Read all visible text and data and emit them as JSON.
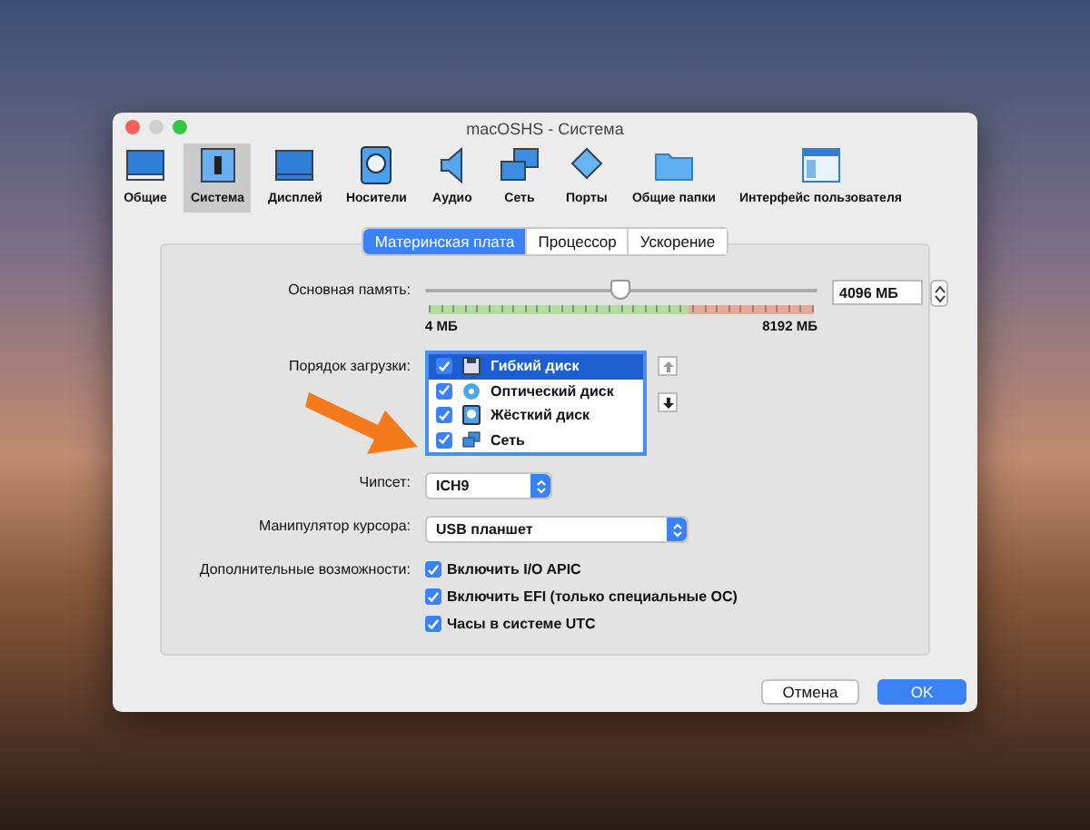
{
  "window": {
    "title": "macOSHS - Система"
  },
  "toolbar": [
    {
      "label": "Общие",
      "kind": "general",
      "selected": false
    },
    {
      "label": "Система",
      "kind": "system",
      "selected": true
    },
    {
      "label": "Дисплей",
      "kind": "display",
      "selected": false
    },
    {
      "label": "Носители",
      "kind": "storage",
      "selected": false
    },
    {
      "label": "Аудио",
      "kind": "audio",
      "selected": false
    },
    {
      "label": "Сеть",
      "kind": "network",
      "selected": false
    },
    {
      "label": "Порты",
      "kind": "ports",
      "selected": false
    },
    {
      "label": "Общие папки",
      "kind": "folder",
      "selected": false
    },
    {
      "label": "Интерфейс пользователя",
      "kind": "ui",
      "selected": false
    }
  ],
  "tabs": [
    {
      "label": "Материнская плата",
      "selected": true
    },
    {
      "label": "Процессор",
      "selected": false
    },
    {
      "label": "Ускорение",
      "selected": false
    }
  ],
  "memory": {
    "label": "Основная память:",
    "value": "4096 МБ",
    "min_label": "4 МБ",
    "max_label": "8192 МБ",
    "level": 0.5
  },
  "boot_order": {
    "label": "Порядок загрузки:",
    "items": [
      {
        "label": "Гибкий диск",
        "kind": "floppy",
        "checked": true,
        "selected": true
      },
      {
        "label": "Оптический диск",
        "kind": "optical",
        "checked": true,
        "selected": false
      },
      {
        "label": "Жёсткий диск",
        "kind": "hdd",
        "checked": true,
        "selected": false
      },
      {
        "label": "Сеть",
        "kind": "network",
        "checked": true,
        "selected": false
      }
    ]
  },
  "chipset": {
    "label": "Чипсет:",
    "value": "ICH9"
  },
  "pointing": {
    "label": "Манипулятор курсора:",
    "value": "USB планшет"
  },
  "extended": {
    "label": "Дополнительные возможности:",
    "options": [
      {
        "label": "Включить I/O APIC",
        "checked": true
      },
      {
        "label": "Включить EFI (только специальные ОС)",
        "checked": true
      },
      {
        "label": "Часы в системе UTC",
        "checked": true
      }
    ]
  },
  "buttons": [
    {
      "label": "Отмена",
      "kind": "secondary"
    },
    {
      "label": "OK",
      "kind": "primary"
    }
  ]
}
